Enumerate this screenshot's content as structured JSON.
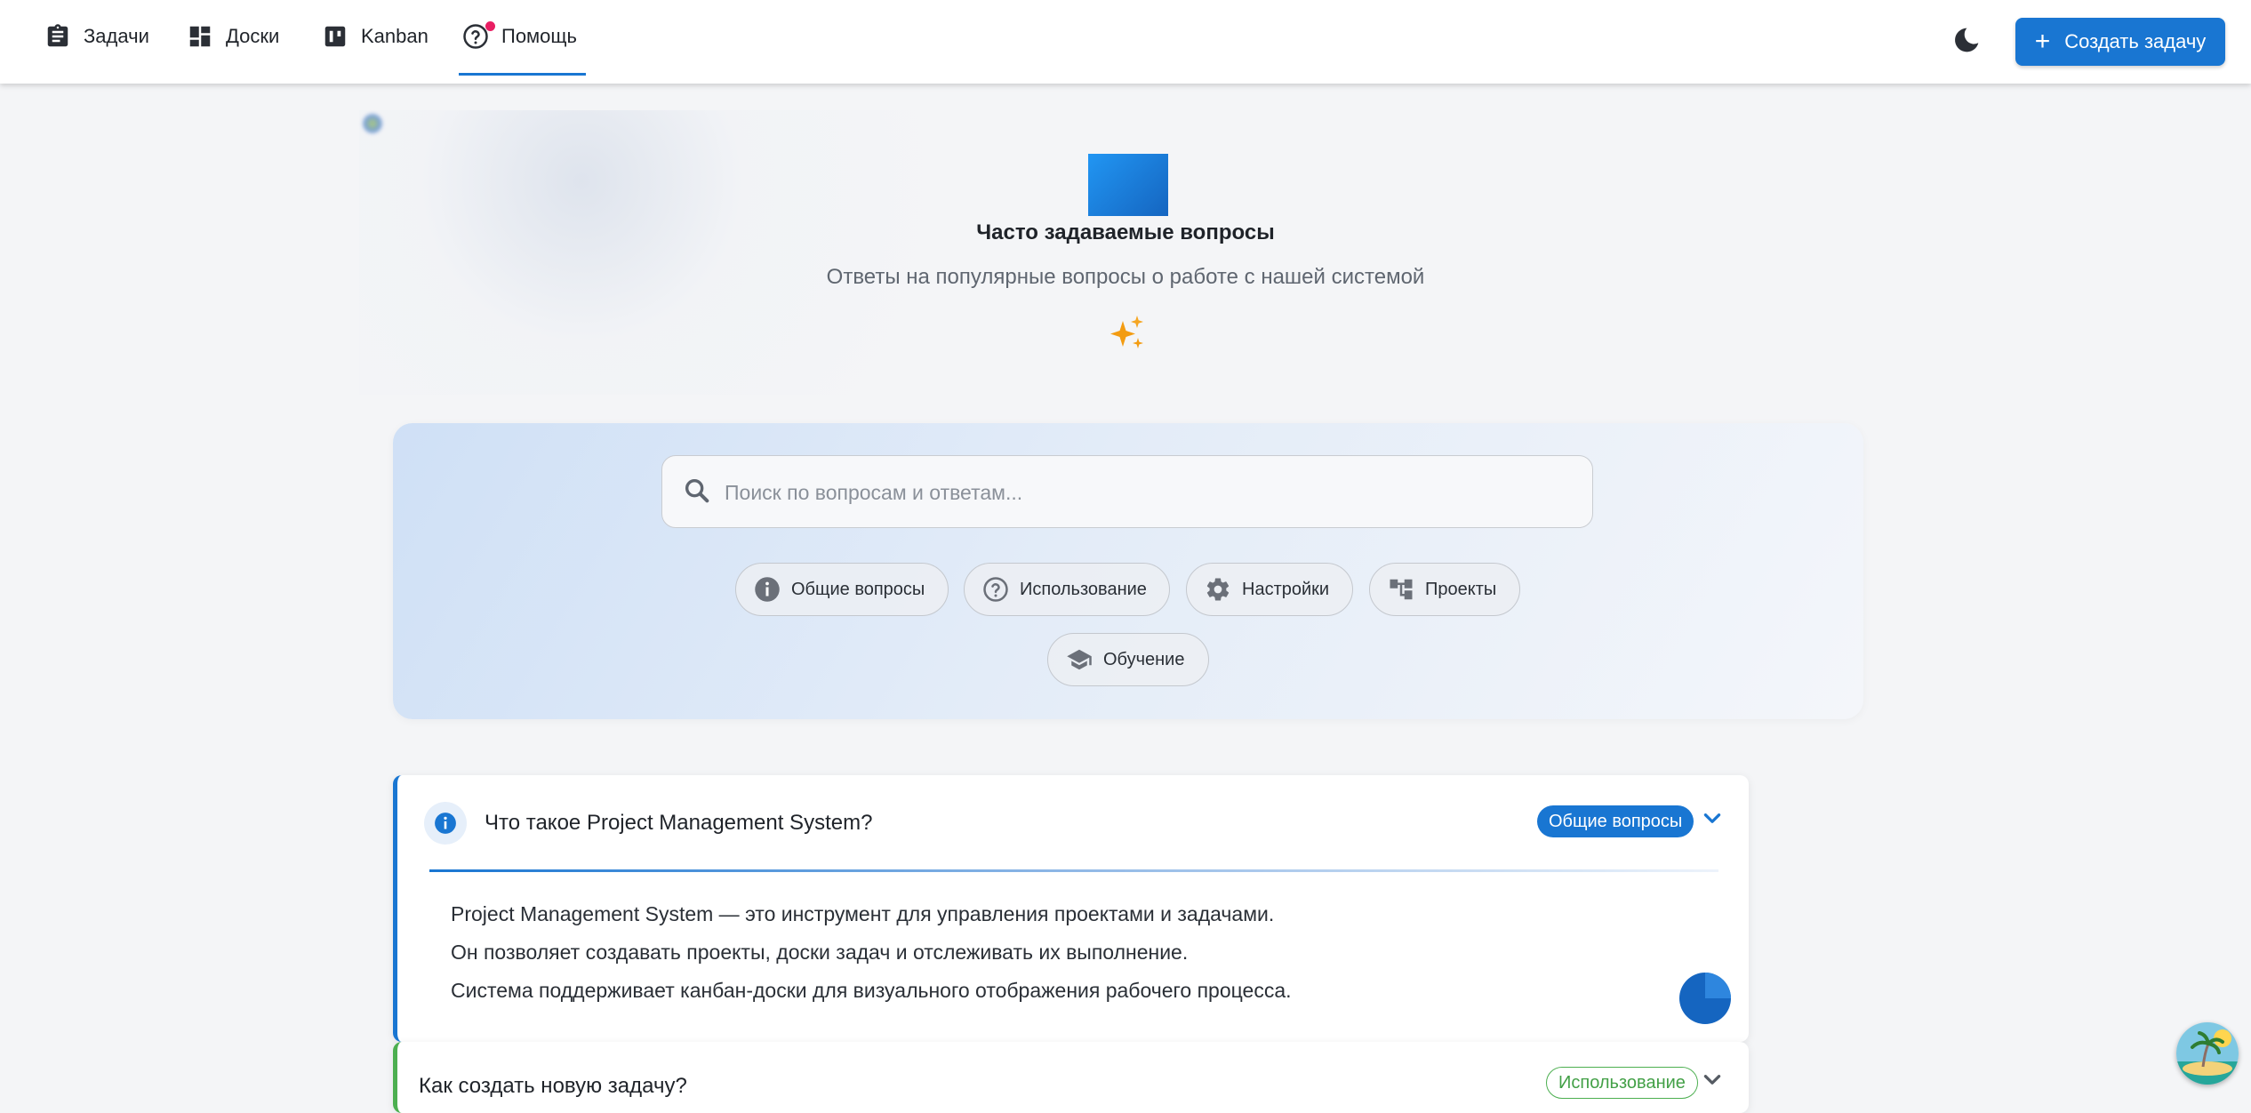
{
  "nav": {
    "items": [
      {
        "label": "Задачи",
        "icon": "clipboard-icon"
      },
      {
        "label": "Доски",
        "icon": "dashboard-icon"
      },
      {
        "label": "Kanban",
        "icon": "kanban-icon"
      },
      {
        "label": "Помощь",
        "icon": "help-icon",
        "active": true
      }
    ],
    "create_label": "Создать задачу",
    "accent": "#1976d2"
  },
  "hero": {
    "title": "Часто задаваемые вопросы",
    "subtitle": "Ответы на популярные вопросы о работе с нашей системой"
  },
  "search": {
    "placeholder": "Поиск по вопросам и ответам...",
    "value": ""
  },
  "categories": [
    {
      "label": "Общие вопросы",
      "icon": "info-icon"
    },
    {
      "label": "Использование",
      "icon": "help-circle-icon"
    },
    {
      "label": "Настройки",
      "icon": "gear-icon"
    },
    {
      "label": "Проекты",
      "icon": "tree-icon"
    },
    {
      "label": "Обучение",
      "icon": "graduation-cap-icon"
    }
  ],
  "faq": [
    {
      "question": "Что такое Project Management System?",
      "category": "Общие вопросы",
      "color": "#1976d2",
      "expanded": true,
      "answer_lines": [
        "Project Management System — это инструмент для управления проектами и задачами.",
        "Он позволяет создавать проекты, доски задач и отслеживать их выполнение.",
        "Система поддерживает канбан-доски для визуального отображения рабочего процесса."
      ]
    },
    {
      "question": "Как создать новую задачу?",
      "category": "Использование",
      "color": "#4caf50",
      "expanded": false
    }
  ]
}
